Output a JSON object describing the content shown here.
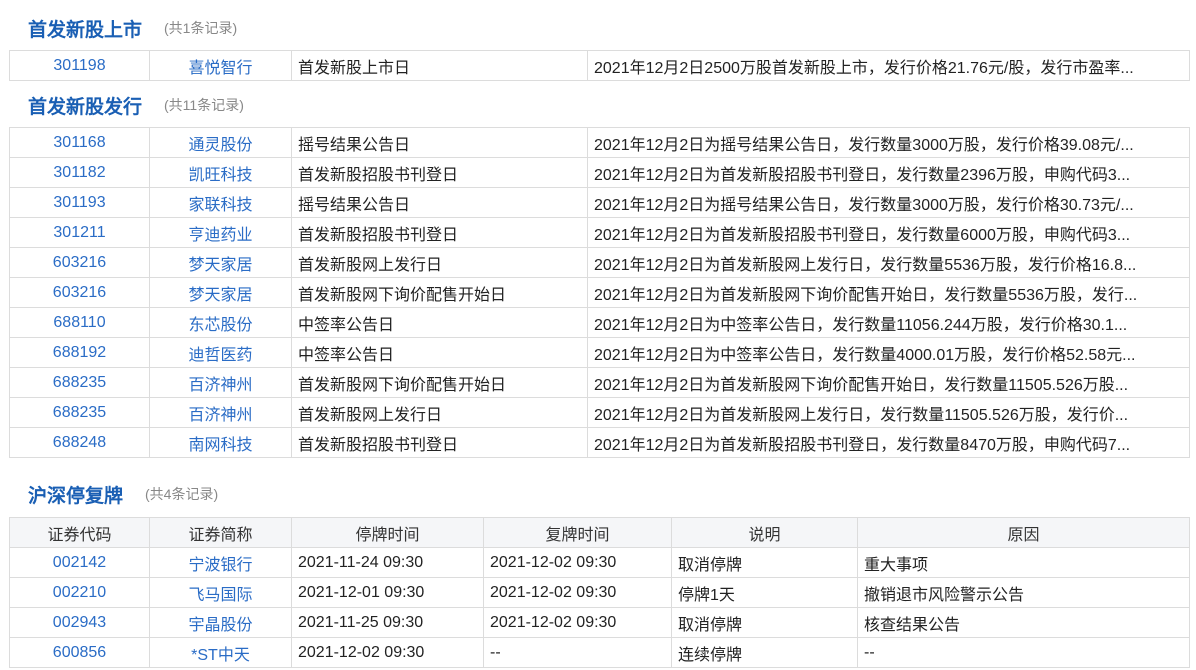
{
  "listing": {
    "title": "首发新股上市",
    "count": "(共1条记录)",
    "rows": [
      {
        "code": "301198",
        "name": "喜悦智行",
        "event": "首发新股上市日",
        "desc": "2021年12月2日2500万股首发新股上市，发行价格21.76元/股，发行市盈率..."
      }
    ]
  },
  "issuance": {
    "title": "首发新股发行",
    "count": "(共11条记录)",
    "rows": [
      {
        "code": "301168",
        "name": "通灵股份",
        "event": "摇号结果公告日",
        "desc": "2021年12月2日为摇号结果公告日，发行数量3000万股，发行价格39.08元/..."
      },
      {
        "code": "301182",
        "name": "凯旺科技",
        "event": "首发新股招股书刊登日",
        "desc": "2021年12月2日为首发新股招股书刊登日，发行数量2396万股，申购代码3..."
      },
      {
        "code": "301193",
        "name": "家联科技",
        "event": "摇号结果公告日",
        "desc": "2021年12月2日为摇号结果公告日，发行数量3000万股，发行价格30.73元/..."
      },
      {
        "code": "301211",
        "name": "亨迪药业",
        "event": "首发新股招股书刊登日",
        "desc": "2021年12月2日为首发新股招股书刊登日，发行数量6000万股，申购代码3..."
      },
      {
        "code": "603216",
        "name": "梦天家居",
        "event": "首发新股网上发行日",
        "desc": "2021年12月2日为首发新股网上发行日，发行数量5536万股，发行价格16.8..."
      },
      {
        "code": "603216",
        "name": "梦天家居",
        "event": "首发新股网下询价配售开始日",
        "desc": "2021年12月2日为首发新股网下询价配售开始日，发行数量5536万股，发行..."
      },
      {
        "code": "688110",
        "name": "东芯股份",
        "event": "中签率公告日",
        "desc": "2021年12月2日为中签率公告日，发行数量11056.244万股，发行价格30.1..."
      },
      {
        "code": "688192",
        "name": "迪哲医药",
        "event": "中签率公告日",
        "desc": "2021年12月2日为中签率公告日，发行数量4000.01万股，发行价格52.58元..."
      },
      {
        "code": "688235",
        "name": "百济神州",
        "event": "首发新股网下询价配售开始日",
        "desc": "2021年12月2日为首发新股网下询价配售开始日，发行数量11505.526万股..."
      },
      {
        "code": "688235",
        "name": "百济神州",
        "event": "首发新股网上发行日",
        "desc": "2021年12月2日为首发新股网上发行日，发行数量11505.526万股，发行价..."
      },
      {
        "code": "688248",
        "name": "南网科技",
        "event": "首发新股招股书刊登日",
        "desc": "2021年12月2日为首发新股招股书刊登日，发行数量8470万股，申购代码7..."
      }
    ]
  },
  "resumption": {
    "title": "沪深停复牌",
    "count": "(共4条记录)",
    "headers": [
      "证券代码",
      "证券简称",
      "停牌时间",
      "复牌时间",
      "说明",
      "原因"
    ],
    "rows": [
      {
        "code": "002142",
        "name": "宁波银行",
        "halt": "2021-11-24 09:30",
        "resume": "2021-12-02 09:30",
        "note": "取消停牌",
        "reason": "重大事项"
      },
      {
        "code": "002210",
        "name": "飞马国际",
        "halt": "2021-12-01 09:30",
        "resume": "2021-12-02 09:30",
        "note": "停牌1天",
        "reason": "撤销退市风险警示公告"
      },
      {
        "code": "002943",
        "name": "宇晶股份",
        "halt": "2021-11-25 09:30",
        "resume": "2021-12-02 09:30",
        "note": "取消停牌",
        "reason": "核查结果公告"
      },
      {
        "code": "600856",
        "name": "*ST中天",
        "halt": "2021-12-02 09:30",
        "resume": "--",
        "note": "连续停牌",
        "reason": "--"
      }
    ]
  }
}
